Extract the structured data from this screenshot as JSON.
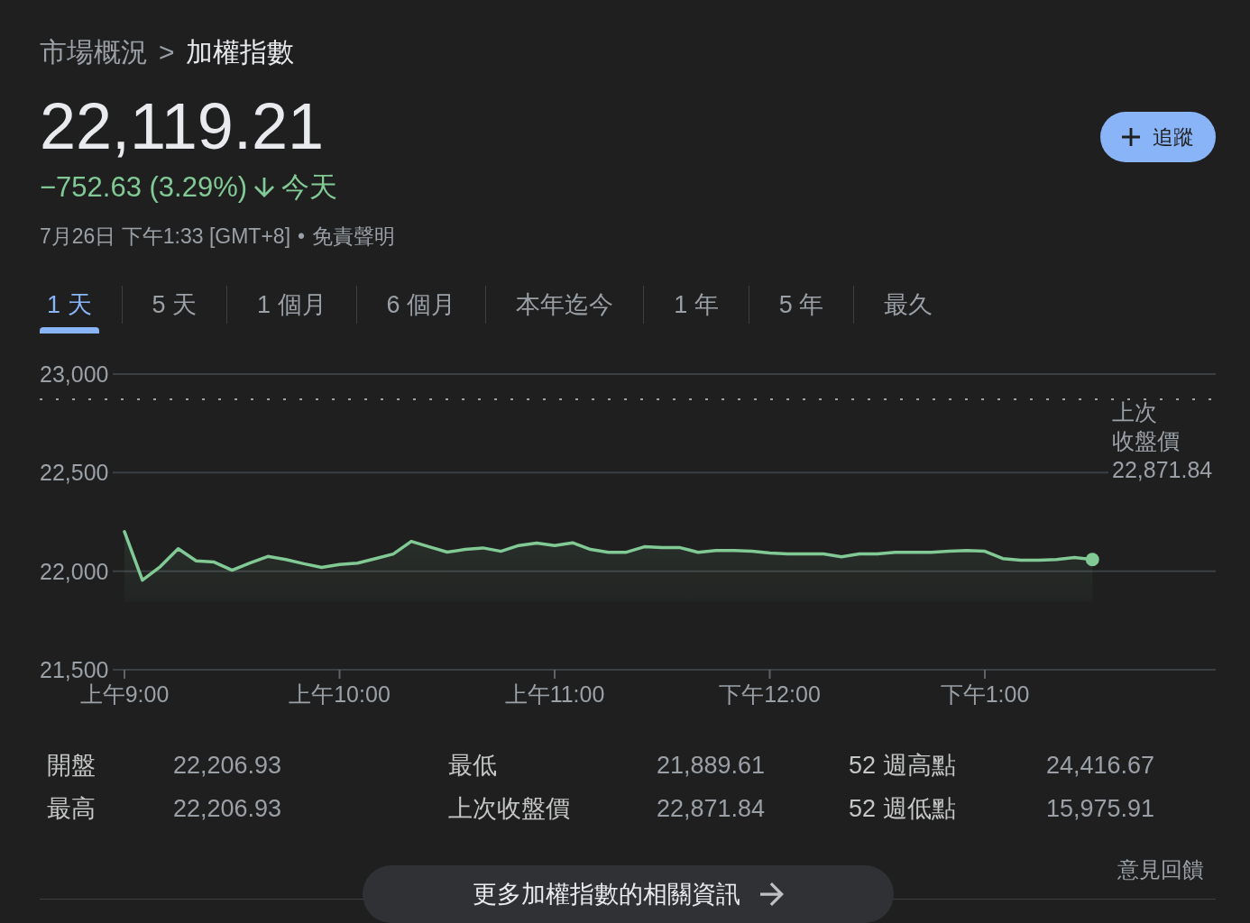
{
  "breadcrumb": {
    "parent": "市場概況",
    "separator": ">",
    "current": "加權指數"
  },
  "quote": {
    "price": "22,119.21",
    "change": "−752.63 (3.29%)",
    "down": true,
    "period": "今天",
    "timestamp": "7月26日 下午1:33 [GMT+8]",
    "separator": "•",
    "disclaimer_link": "免責聲明"
  },
  "follow_button": {
    "label": "追蹤"
  },
  "range_tabs": [
    {
      "label": "1 天",
      "selected": true
    },
    {
      "label": "5 天",
      "selected": false
    },
    {
      "label": "1 個月",
      "selected": false
    },
    {
      "label": "6 個月",
      "selected": false
    },
    {
      "label": "本年迄今",
      "selected": false
    },
    {
      "label": "1 年",
      "selected": false
    },
    {
      "label": "5 年",
      "selected": false
    },
    {
      "label": "最久",
      "selected": false
    }
  ],
  "chart": {
    "chart_data": {
      "type": "area",
      "categories": [
        "上午9:00",
        null,
        null,
        null,
        null,
        null,
        null,
        null,
        null,
        null,
        null,
        null,
        "上午10:00",
        null,
        null,
        null,
        null,
        null,
        null,
        null,
        null,
        null,
        null,
        null,
        "上午11:00",
        null,
        null,
        null,
        null,
        null,
        null,
        null,
        null,
        null,
        null,
        null,
        "下午12:00",
        null,
        null,
        null,
        null,
        null,
        null,
        null,
        null,
        null,
        null,
        null,
        "下午1:00",
        null,
        null,
        null,
        null,
        null,
        null,
        null,
        null,
        null,
        null,
        null,
        null
      ],
      "series": [
        {
          "color": "#81c995",
          "values": [
            22200,
            21954,
            22023,
            22114,
            22052,
            22046,
            22005,
            22041,
            22075,
            22059,
            22038,
            22019,
            22034,
            22041,
            22064,
            22087,
            22151,
            22124,
            22097,
            22110,
            22118,
            22101,
            22130,
            22142,
            22130,
            22144,
            22110,
            22096,
            22096,
            22124,
            22119,
            22119,
            22096,
            22105,
            22105,
            22101,
            22092,
            22087,
            22087,
            22087,
            22073,
            22087,
            22087,
            22096,
            22096,
            22096,
            22101,
            22105,
            22101,
            22064,
            22055,
            22055,
            22059,
            22069,
            22059,
            null,
            null,
            null,
            null,
            null,
            null
          ]
        }
      ],
      "ylim": [
        21500,
        23000
      ],
      "yticks": [
        {
          "value": 21500,
          "label": "21,500"
        },
        {
          "value": 22000,
          "label": "22,000"
        },
        {
          "value": 22500,
          "label": "22,500"
        },
        {
          "value": 23000,
          "label": "23,000"
        }
      ],
      "ref_lines": [
        {
          "axis": "y",
          "value": 22871.84,
          "label": "上次收盤價"
        }
      ],
      "annotations": [
        {
          "y": 22871.84,
          "text": "22,871.84"
        }
      ]
    }
  },
  "stats": [
    {
      "label": "開盤",
      "value": "22,206.93"
    },
    {
      "label": "最低",
      "value": "21,889.61"
    },
    {
      "label": "52 週高點",
      "value": "24,416.67"
    },
    {
      "label": "最高",
      "value": "22,206.93"
    },
    {
      "label": "上次收盤價",
      "value": "22,871.84"
    },
    {
      "label": "52 週低點",
      "value": "15,975.91"
    }
  ],
  "more_info_button": {
    "label": "更多加權指數的相關資訊"
  },
  "feedback_link": {
    "label": "意見回饋"
  }
}
